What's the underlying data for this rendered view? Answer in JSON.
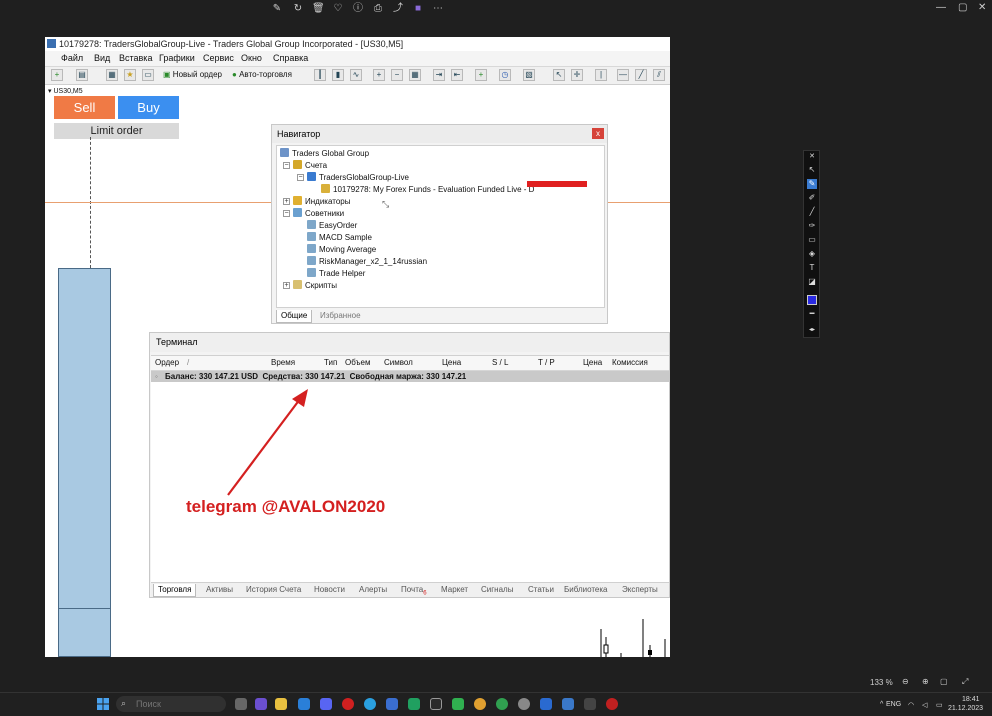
{
  "viewer": {
    "zoom": "133 %",
    "top_icons": [
      "edit-icon",
      "rotate-icon",
      "trash-icon",
      "heart-icon",
      "info-icon",
      "print-icon",
      "share-icon",
      "onenote-icon",
      "more-icon"
    ]
  },
  "window": {
    "title": "10179278: TradersGlobalGroup-Live - Traders Global Group Incorporated - [US30,M5]",
    "menu": [
      "Файл",
      "Вид",
      "Вставка",
      "Графики",
      "Сервис",
      "Окно",
      "Справка"
    ],
    "toolbar": {
      "new_order": "Новый ордер",
      "autotrading": "Авто-торговля"
    }
  },
  "chart": {
    "symbol": "US30,M5",
    "sell": "Sell",
    "buy": "Buy",
    "limit_order": "Limit order"
  },
  "navigator": {
    "title": "Навигатор",
    "close": "x",
    "tree": {
      "root": "Traders Global Group",
      "accounts": "Счета",
      "server": "TradersGlobalGroup-Live",
      "account": "10179278: My Forex Funds - Evaluation Funded Live - D",
      "indicators": "Индикаторы",
      "advisors": "Советники",
      "ea_items": [
        "EasyOrder",
        "MACD Sample",
        "Moving Average",
        "RiskManager_x2_1_14russian",
        "Trade Helper"
      ],
      "scripts": "Скрипты"
    },
    "tabs": [
      "Общие",
      "Избранное"
    ]
  },
  "terminal": {
    "title": "Терминал",
    "columns": [
      "Ордер",
      "/",
      "Время",
      "Тип",
      "Объем",
      "Символ",
      "Цена",
      "S / L",
      "T / P",
      "Цена",
      "Комиссия"
    ],
    "balance_row": "Баланс: 330 147.21 USD  Средства: 330 147.21  Свободная маржа: 330 147.21",
    "tabs": [
      "Торговля",
      "Активы",
      "История Счета",
      "Новости",
      "Алерты",
      "Почта",
      "Маркет",
      "Сигналы",
      "Статьи",
      "Библиотека",
      "Эксперты"
    ],
    "mail_badge": "6"
  },
  "annotation": {
    "text": "telegram @AVALON2020",
    "color": "#d42020"
  },
  "taskbar": {
    "search_placeholder": "Поиск",
    "lang": "ENG",
    "time": "18:41",
    "date": "21.12.2023"
  }
}
